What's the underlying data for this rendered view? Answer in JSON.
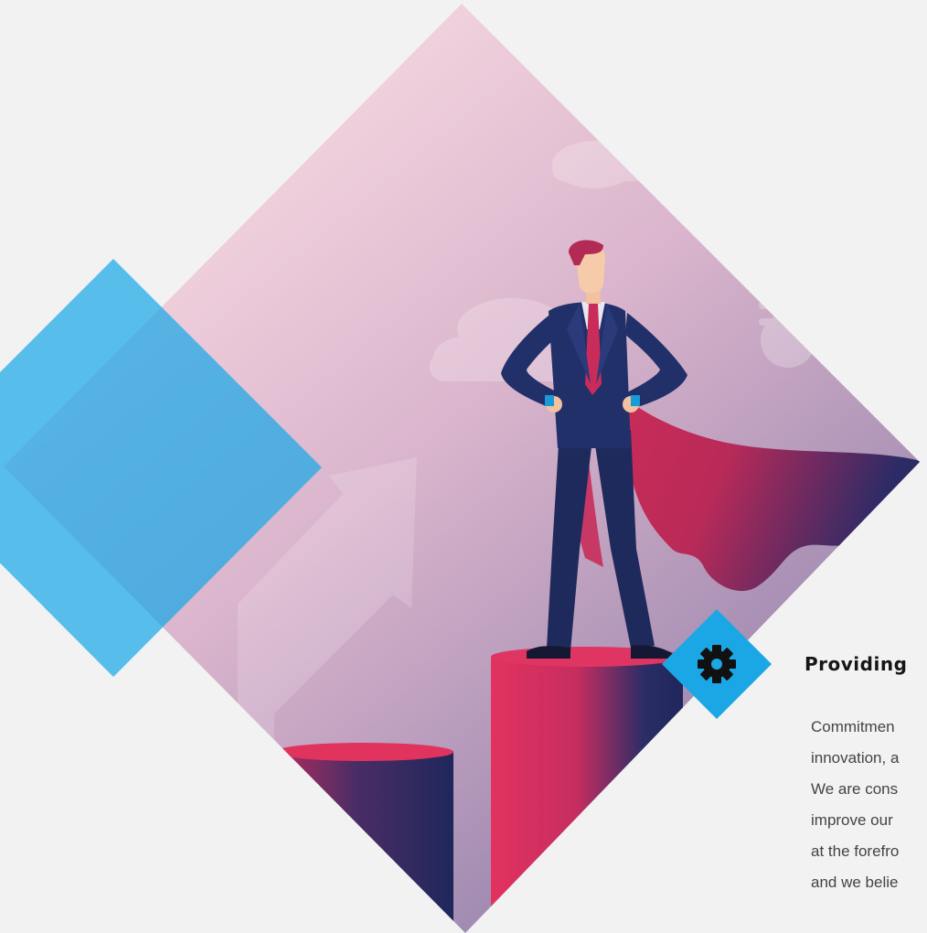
{
  "feature": {
    "icon": "gear-icon",
    "title": "Providing",
    "body_lines": [
      "Commitmen",
      "innovation, a",
      "We are cons",
      "improve our",
      "at the forefro",
      "and we belie"
    ]
  },
  "colors": {
    "page_background": "#f2f2f2",
    "accent_blue": "#1ba7e6",
    "gradient_pink": "#f9d3dc",
    "gradient_purple": "#8e7ba6",
    "suit_navy": "#1f2a5c",
    "cape_crimson": "#d8325b",
    "title_text": "#161616",
    "body_text": "#444444"
  }
}
